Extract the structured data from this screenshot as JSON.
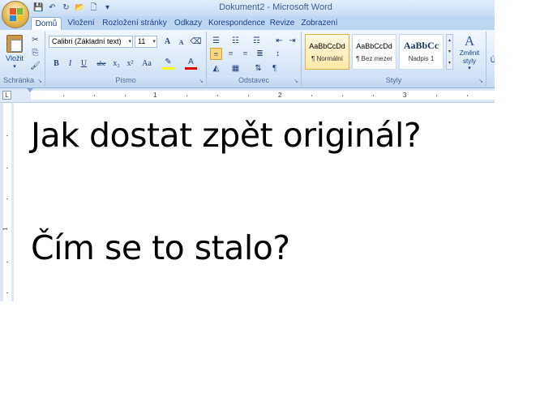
{
  "window": {
    "title": "Dokument2 - Microsoft Word"
  },
  "tabs": [
    {
      "label": "Domů",
      "active": true
    },
    {
      "label": "Vložení",
      "active": false
    },
    {
      "label": "Rozložení stránky",
      "active": false
    },
    {
      "label": "Odkazy",
      "active": false
    },
    {
      "label": "Korespondence",
      "active": false
    },
    {
      "label": "Revize",
      "active": false
    },
    {
      "label": "Zobrazení",
      "active": false
    }
  ],
  "ribbon": {
    "clipboard": {
      "label": "Schránka",
      "paste_label": "Vložit",
      "paste_arrow": "▾"
    },
    "font": {
      "label": "Písmo",
      "font_name": "Calibri (Základní text)",
      "font_size": "11",
      "grow": "A",
      "shrink": "A",
      "bold": "B",
      "italic": "I",
      "underline": "U",
      "strike": "abc",
      "subscript": "x₂",
      "superscript": "x²",
      "change_case": "Aa",
      "font_color": "A"
    },
    "paragraph": {
      "label": "Odstavec"
    },
    "styles": {
      "label": "Styly",
      "items": [
        {
          "sample": "AaBbCcDd",
          "name": "¶ Normální",
          "selected": true
        },
        {
          "sample": "AaBbCcDd",
          "name": "¶ Bez mezer",
          "selected": false
        },
        {
          "sample": "AaBbCc",
          "name": "Nadpis 1",
          "selected": false
        }
      ],
      "change_styles": "Změnit styly",
      "change_styles_arrow": "▾",
      "edit_partial": "Ú"
    }
  },
  "ruler": {
    "corner": "L",
    "numbers": [
      "1",
      "2",
      "3"
    ]
  },
  "vruler": {
    "numbers": [
      "1"
    ]
  },
  "document": {
    "lines": [
      "Jak dostat zpět originál?",
      "Čím se to stalo?"
    ]
  },
  "colors": {
    "ribbon_bg": "#dbe8f8",
    "tab_text": "#15428b",
    "selected_style": "#ffe8a6"
  }
}
